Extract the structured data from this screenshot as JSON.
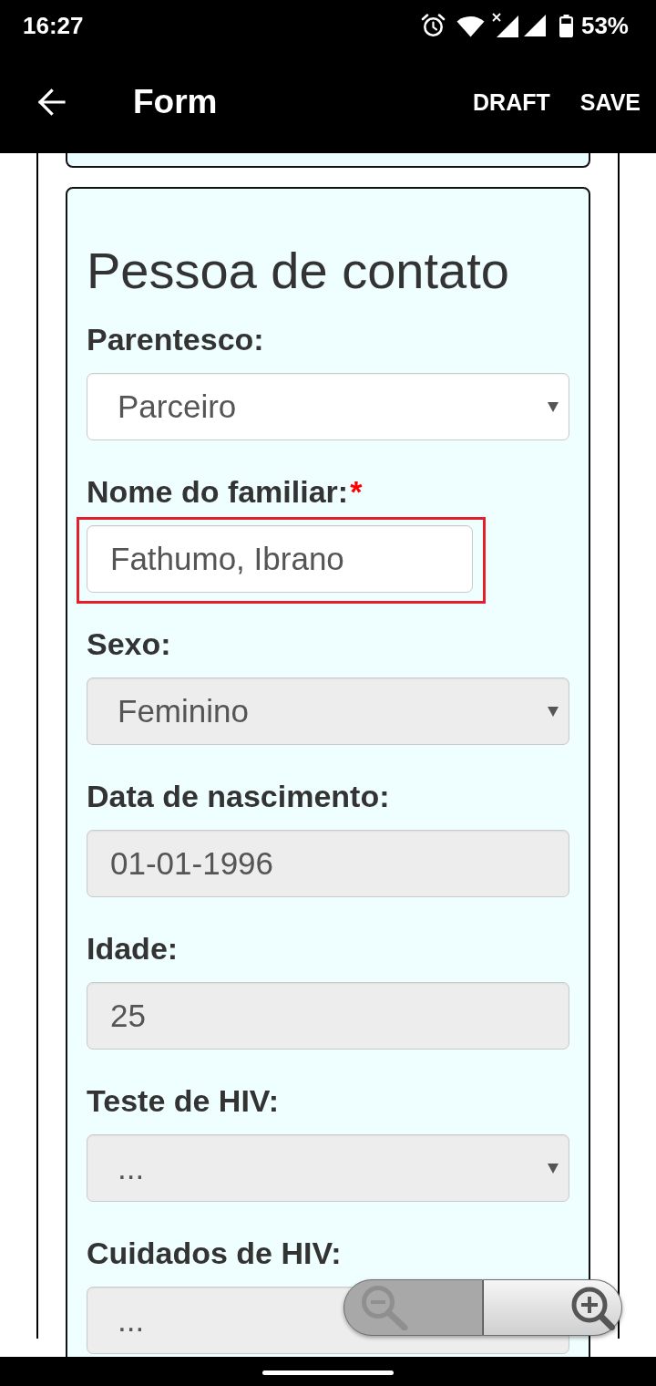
{
  "status_bar": {
    "time": "16:27",
    "battery": "53%"
  },
  "app_bar": {
    "title": "Form",
    "actions": [
      "DRAFT",
      "SAVE"
    ]
  },
  "section": {
    "title": "Pessoa de contato",
    "fields": [
      {
        "kind": "select",
        "label": "Parentesco:",
        "value": "Parceiro",
        "disabled": false,
        "highlighted": false
      },
      {
        "kind": "text",
        "label": "Nome do familiar:",
        "required_mark": "*",
        "value": "Fathumo, Ibrano",
        "disabled": false,
        "highlighted": true
      },
      {
        "kind": "select",
        "label": "Sexo:",
        "value": "Feminino",
        "disabled": true,
        "highlighted": false
      },
      {
        "kind": "text",
        "label": "Data de nascimento:",
        "value": "01-01-1996",
        "disabled": true,
        "highlighted": false
      },
      {
        "kind": "text",
        "label": "Idade:",
        "value": "25",
        "disabled": true,
        "highlighted": false
      },
      {
        "kind": "select",
        "label": "Teste de HIV:",
        "value": "...",
        "disabled": true,
        "highlighted": false
      },
      {
        "kind": "select",
        "label": "Cuidados de HIV:",
        "value": "...",
        "disabled": true,
        "highlighted": false
      }
    ]
  },
  "zoom_controls": [
    {
      "kind": "zoom_out",
      "disabled": true
    },
    {
      "kind": "zoom_in",
      "disabled": false
    }
  ]
}
